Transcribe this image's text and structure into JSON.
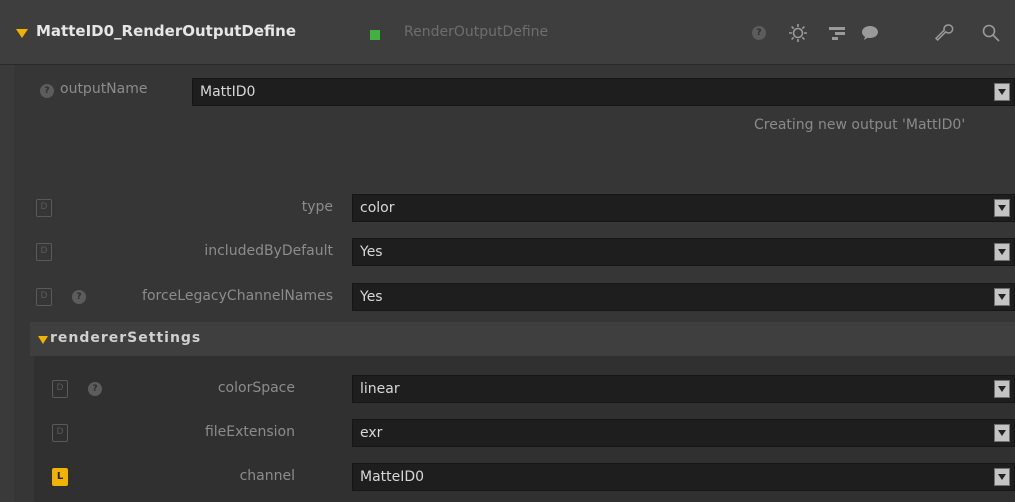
{
  "header": {
    "node_name": "MatteID0_RenderOutputDefine",
    "node_type": "RenderOutputDefine",
    "status_color": "#3fb23f",
    "icons": [
      "help-icon",
      "settings-gear-icon",
      "node-graph-icon",
      "comment-icon",
      "wrench-icon",
      "search-icon"
    ]
  },
  "output_name": {
    "label": "outputName",
    "value": "MattID0",
    "message": "Creating new output 'MattID0'"
  },
  "params": {
    "type": {
      "badge": "D",
      "label": "type",
      "value": "color"
    },
    "included": {
      "badge": "D",
      "label": "includedByDefault",
      "value": "Yes"
    },
    "legacy": {
      "badge": "D",
      "label": "forceLegacyChannelNames",
      "value": "Yes"
    }
  },
  "renderer_settings": {
    "title": "rendererSettings",
    "color_space": {
      "badge": "D",
      "label": "colorSpace",
      "value": "linear"
    },
    "file_extension": {
      "badge": "D",
      "label": "fileExtension",
      "value": "exr"
    },
    "channel": {
      "badge": "L",
      "label": "channel",
      "value": "MatteID0"
    }
  },
  "colors": {
    "accent": "#f0b400",
    "status": "#3fb23f"
  }
}
